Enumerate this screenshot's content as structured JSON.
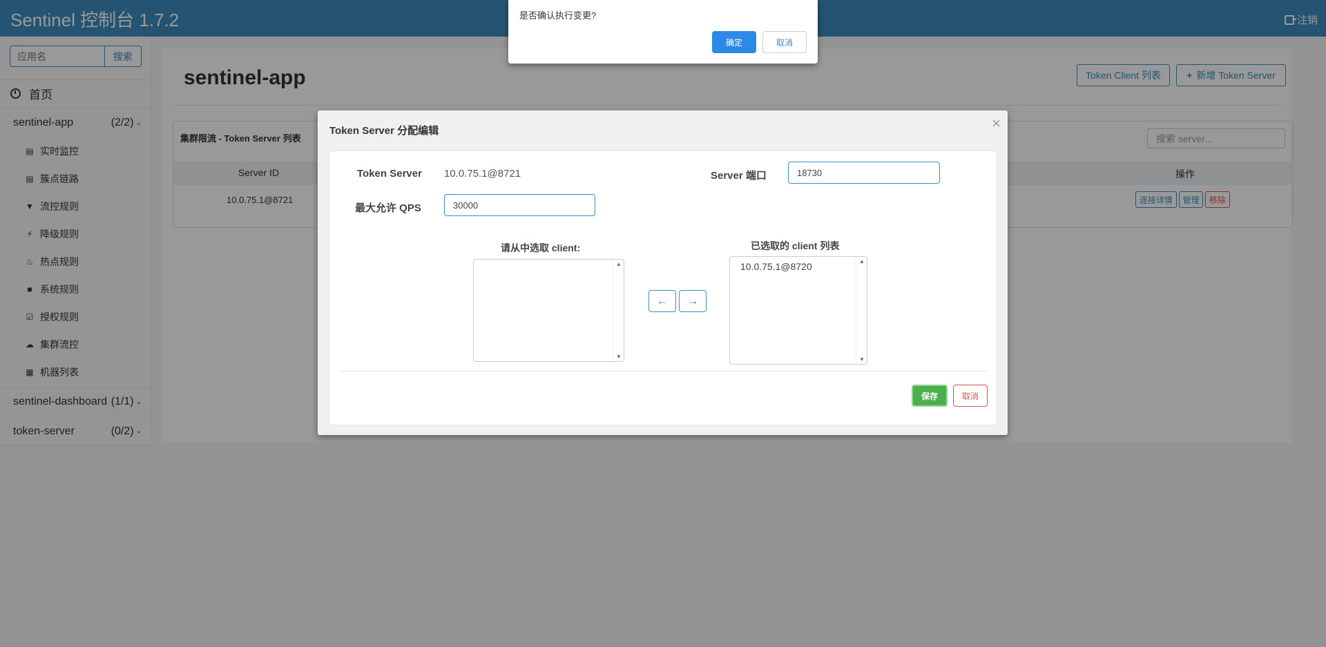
{
  "header": {
    "brand": "Sentinel 控制台 1.7.2",
    "logout": "注销"
  },
  "sidebar": {
    "search_placeholder": "应用名",
    "search_button": "搜索",
    "home": "首页",
    "apps": [
      {
        "name": "sentinel-app",
        "count": "(2/2)"
      },
      {
        "name": "sentinel-dashboard",
        "count": "(1/1)"
      },
      {
        "name": "token-server",
        "count": "(0/2)"
      }
    ],
    "menu": [
      {
        "label": "实时监控",
        "icon": "bar-chart-icon"
      },
      {
        "label": "簇点链路",
        "icon": "list-icon"
      },
      {
        "label": "流控规则",
        "icon": "filter-icon"
      },
      {
        "label": "降级规则",
        "icon": "flash-icon"
      },
      {
        "label": "热点规则",
        "icon": "fire-icon"
      },
      {
        "label": "系统规则",
        "icon": "lock-icon"
      },
      {
        "label": "授权规则",
        "icon": "check-icon"
      },
      {
        "label": "集群流控",
        "icon": "cloud-icon"
      },
      {
        "label": "机器列表",
        "icon": "grid-icon"
      }
    ]
  },
  "main": {
    "title": "sentinel-app",
    "btn_client_list": "Token Client 列表",
    "btn_add_server": "新增 Token Server",
    "card_title": "集群限流 - Token Server 列表",
    "search_placeholder": "搜索 server...",
    "columns": {
      "server_id": "Server ID",
      "ops": "操作"
    },
    "rows": [
      {
        "server_id": "10.0.75.1@8721",
        "ops": [
          "连接详情",
          "管理",
          "移除"
        ]
      }
    ]
  },
  "modal": {
    "title": "Token Server 分配编辑",
    "close": "×",
    "token_server_label": "Token Server",
    "token_server_value": "10.0.75.1@8721",
    "port_label": "Server 端口",
    "port_value": "18730",
    "qps_label": "最大允许 QPS",
    "qps_value": "30000",
    "left_list_label": "请从中选取 client:",
    "right_list_label": "已选取的 client 列表",
    "selected_clients": [
      "10.0.75.1@8720"
    ],
    "arrow_left": "←",
    "arrow_right": "→",
    "save": "保存",
    "cancel": "取消"
  },
  "confirm": {
    "message": "是否确认执行变更?",
    "ok": "确定",
    "cancel": "取消"
  },
  "colors": {
    "primary": "#3c8dbc",
    "success": "#4cae4c",
    "danger": "#d9534f",
    "confirm": "#2d89e8"
  }
}
